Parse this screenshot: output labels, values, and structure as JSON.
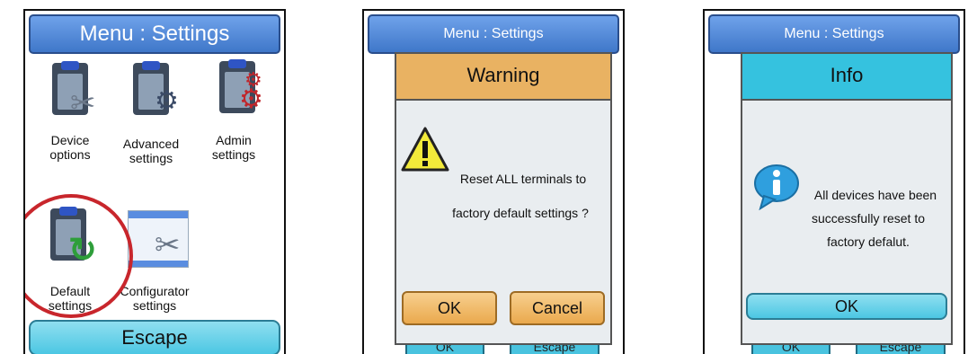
{
  "screen1": {
    "title": "Menu : Settings",
    "tiles": [
      {
        "label_line1": "Device",
        "label_line2": "options"
      },
      {
        "label_line1": "Advanced",
        "label_line2": "settings"
      },
      {
        "label_line1": "Admin",
        "label_line2": "settings"
      },
      {
        "label_line1": "Default",
        "label_line2": "settings"
      },
      {
        "label_line1": "Configurator",
        "label_line2": "settings"
      }
    ],
    "escape_label": "Escape",
    "highlight_color": "#c8262c"
  },
  "screen2": {
    "title": "Menu : Settings",
    "dialog_title": "Warning",
    "message_line1": "Reset ALL terminals to",
    "message_line2": "factory default settings ?",
    "ok_label": "OK",
    "cancel_label": "Cancel",
    "behind_ok_label": "OK",
    "behind_escape_label": "Escape",
    "accent_color": "#e9b262"
  },
  "screen3": {
    "title": "Menu : Settings",
    "dialog_title": "Info",
    "message_line1": "All devices have been",
    "message_line2": "successfully reset to",
    "message_line3": "factory defalut.",
    "ok_label": "OK",
    "behind_ok_label": "OK",
    "behind_escape_label": "Escape",
    "accent_color": "#35c2df"
  }
}
